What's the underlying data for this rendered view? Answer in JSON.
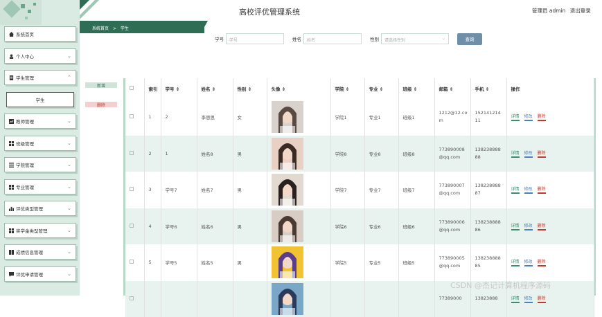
{
  "header": {
    "title": "高校评优管理系统",
    "user_text": "管理员 admin",
    "logout": "退出登录"
  },
  "breadcrumb": {
    "home": "系统首页",
    "sep": ">",
    "current": "学生"
  },
  "sidebar": {
    "items": [
      {
        "label": "系统首页",
        "icon": "home-icon",
        "chev": ""
      },
      {
        "label": "个人中心",
        "icon": "user-icon",
        "chev": "⌄"
      },
      {
        "label": "学生管理",
        "icon": "doc-icon",
        "chev": "⌃"
      },
      {
        "label": "学生",
        "icon": "",
        "chev": ""
      },
      {
        "label": "教师管理",
        "icon": "chart-icon",
        "chev": "⌄"
      },
      {
        "label": "班级管理",
        "icon": "grid-icon",
        "chev": "⌄"
      },
      {
        "label": "学院管理",
        "icon": "list-icon",
        "chev": "⌄"
      },
      {
        "label": "专业管理",
        "icon": "grid-icon",
        "chev": "⌄"
      },
      {
        "label": "评优类型管理",
        "icon": "bar-icon",
        "chev": "⌄"
      },
      {
        "label": "奖学金类型管理",
        "icon": "grid-icon",
        "chev": "⌄"
      },
      {
        "label": "成绩信息管理",
        "icon": "book-icon",
        "chev": "⌄"
      },
      {
        "label": "评优申请管理",
        "icon": "msg-icon",
        "chev": "⌄"
      }
    ]
  },
  "search": {
    "sid_label": "学号",
    "sid_placeholder": "学号",
    "name_label": "姓名",
    "name_placeholder": "姓名",
    "gender_label": "性别",
    "gender_placeholder": "请选择性别",
    "button": "查询"
  },
  "actions": {
    "add": "新增",
    "delete": "删除"
  },
  "table": {
    "columns": [
      "索引",
      "学号 ⇕",
      "姓名 ⇕",
      "性别 ⇕",
      "头像 ⇕",
      "学院 ⇕",
      "专业 ⇕",
      "班级 ⇕",
      "邮箱 ⇕",
      "手机 ⇕",
      "操作"
    ],
    "rows": [
      {
        "idx": "1",
        "sid": "2",
        "name": "李思思",
        "gender": "女",
        "college": "学院1",
        "major": "专业1",
        "cls": "班级1",
        "email": "1212@12.com",
        "phone": "15214121411"
      },
      {
        "idx": "2",
        "sid": "1",
        "name": "姓名8",
        "gender": "男",
        "college": "学院8",
        "major": "专业8",
        "cls": "班级8",
        "email": "773890008@qq.com",
        "phone": "13823888888"
      },
      {
        "idx": "3",
        "sid": "学号7",
        "name": "姓名7",
        "gender": "男",
        "college": "学院7",
        "major": "专业7",
        "cls": "班级7",
        "email": "773890007@qq.com",
        "phone": "13823888887"
      },
      {
        "idx": "4",
        "sid": "学号6",
        "name": "姓名6",
        "gender": "男",
        "college": "学院6",
        "major": "专业6",
        "cls": "班级6",
        "email": "773890006@qq.com",
        "phone": "13823888886"
      },
      {
        "idx": "5",
        "sid": "学号5",
        "name": "姓名5",
        "gender": "男",
        "college": "学院5",
        "major": "专业5",
        "cls": "班级5",
        "email": "773890005@qq.com",
        "phone": "13823888885"
      },
      {
        "idx": "",
        "sid": "",
        "name": "",
        "gender": "",
        "college": "",
        "major": "",
        "cls": "",
        "email": "77389000",
        "phone": "13823888"
      }
    ],
    "ops": {
      "detail": "详情",
      "edit": "修改",
      "del": "删除"
    }
  },
  "watermark": "CSDN @杰记计算机程序源码",
  "colors": {
    "accent": "#2f6e55",
    "sidebar_bg": "#d9ebe2",
    "row_alt": "#e8f2ee",
    "query_btn": "#6e8fa7"
  }
}
